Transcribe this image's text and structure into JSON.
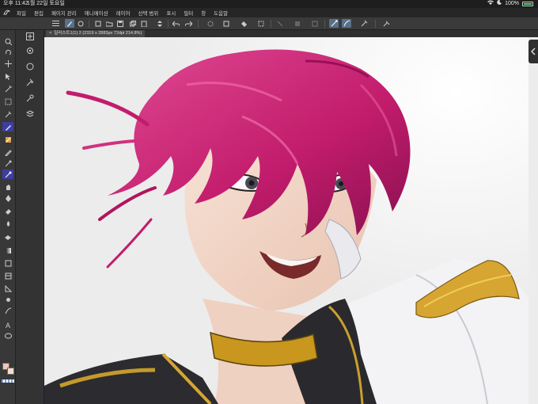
{
  "status": {
    "time": "오후 11:42",
    "date": "1월 22일 토요일",
    "battery": "100%"
  },
  "menu": {
    "items": [
      "파일",
      "편집",
      "페이지 관리",
      "애니메이션",
      "레이어",
      "선택 범위",
      "표시",
      "필터",
      "창",
      "도움말"
    ]
  },
  "document": {
    "close": "×",
    "title": "일러스트1(1) 2 (2319 x 2883px 72dpi 214.8%)"
  },
  "colors": {
    "main_color": "#f0c8b8",
    "sub_color": "#f6dcd0",
    "active_tool": "#3f3ea0",
    "active_command": "#5a6f8a"
  },
  "icons": {
    "commands": [
      "undo-icon",
      "redo-icon",
      "new-icon",
      "open-icon",
      "save-icon",
      "snap-icon",
      "transform-icon",
      "fill-icon",
      "clear-icon",
      "select-icon",
      "ruler-icon",
      "pen-stabilizer-icon",
      "eyedropper-icon",
      "reference-icon"
    ],
    "tools": [
      "zoom-icon",
      "rotate-icon",
      "move-icon",
      "object-icon",
      "rectangle-select-icon",
      "auto-select-icon",
      "eyedropper-icon",
      "pen-icon",
      "pencil-icon",
      "brush-icon",
      "airbrush-icon",
      "decoration-icon",
      "eraser-icon",
      "blend-icon",
      "fill-icon",
      "gradient-icon",
      "figure-icon",
      "frame-icon",
      "ruler-icon",
      "text-icon",
      "balloon-icon",
      "line-correction-icon"
    ]
  }
}
